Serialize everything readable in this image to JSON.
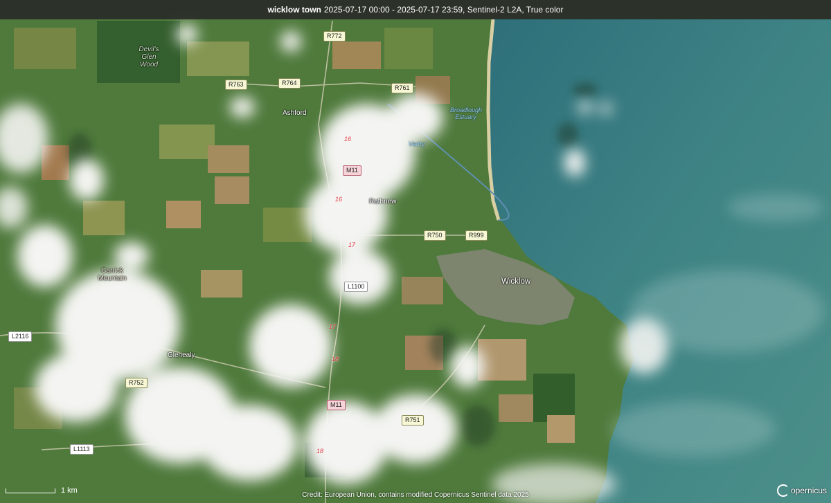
{
  "title": {
    "aoi": "wicklow town",
    "details": "2025-07-17 00:00 - 2025-07-17 23:59, Sentinel-2 L2A, True color"
  },
  "places": {
    "ashford": "Ashford",
    "rathnew": "Rathnew",
    "wicklow": "Wicklow",
    "glenealy": "Glenealy",
    "devils_glen": "Devil's Glen Wood",
    "carrick": "Carrick Mountain"
  },
  "water": {
    "broadlough": "Broadlough Estuary",
    "vartry": "Vartry"
  },
  "shields": {
    "r772": "R772",
    "r763": "R763",
    "r764": "R764",
    "r761": "R761",
    "m11_a": "M11",
    "r750": "R750",
    "r999": "R999",
    "l1100": "L1100",
    "l2116": "L2116",
    "r752": "R752",
    "m11_b": "M11",
    "r751": "R751",
    "l1113": "L1113"
  },
  "junctions": {
    "j16a": "16",
    "j16b": "16",
    "j17a": "17",
    "j17b": "17",
    "j18a": "18",
    "j18b": "18"
  },
  "scale": {
    "label": "1 km"
  },
  "credit": "Credit: European Union, contains modified Copernicus Sentinel data 2025",
  "logo": "opernicus",
  "colors": {
    "sea": "#3b7a80",
    "land": "#4a6e35",
    "cloud": "#f3f3f1",
    "title_bar": "#282828"
  }
}
